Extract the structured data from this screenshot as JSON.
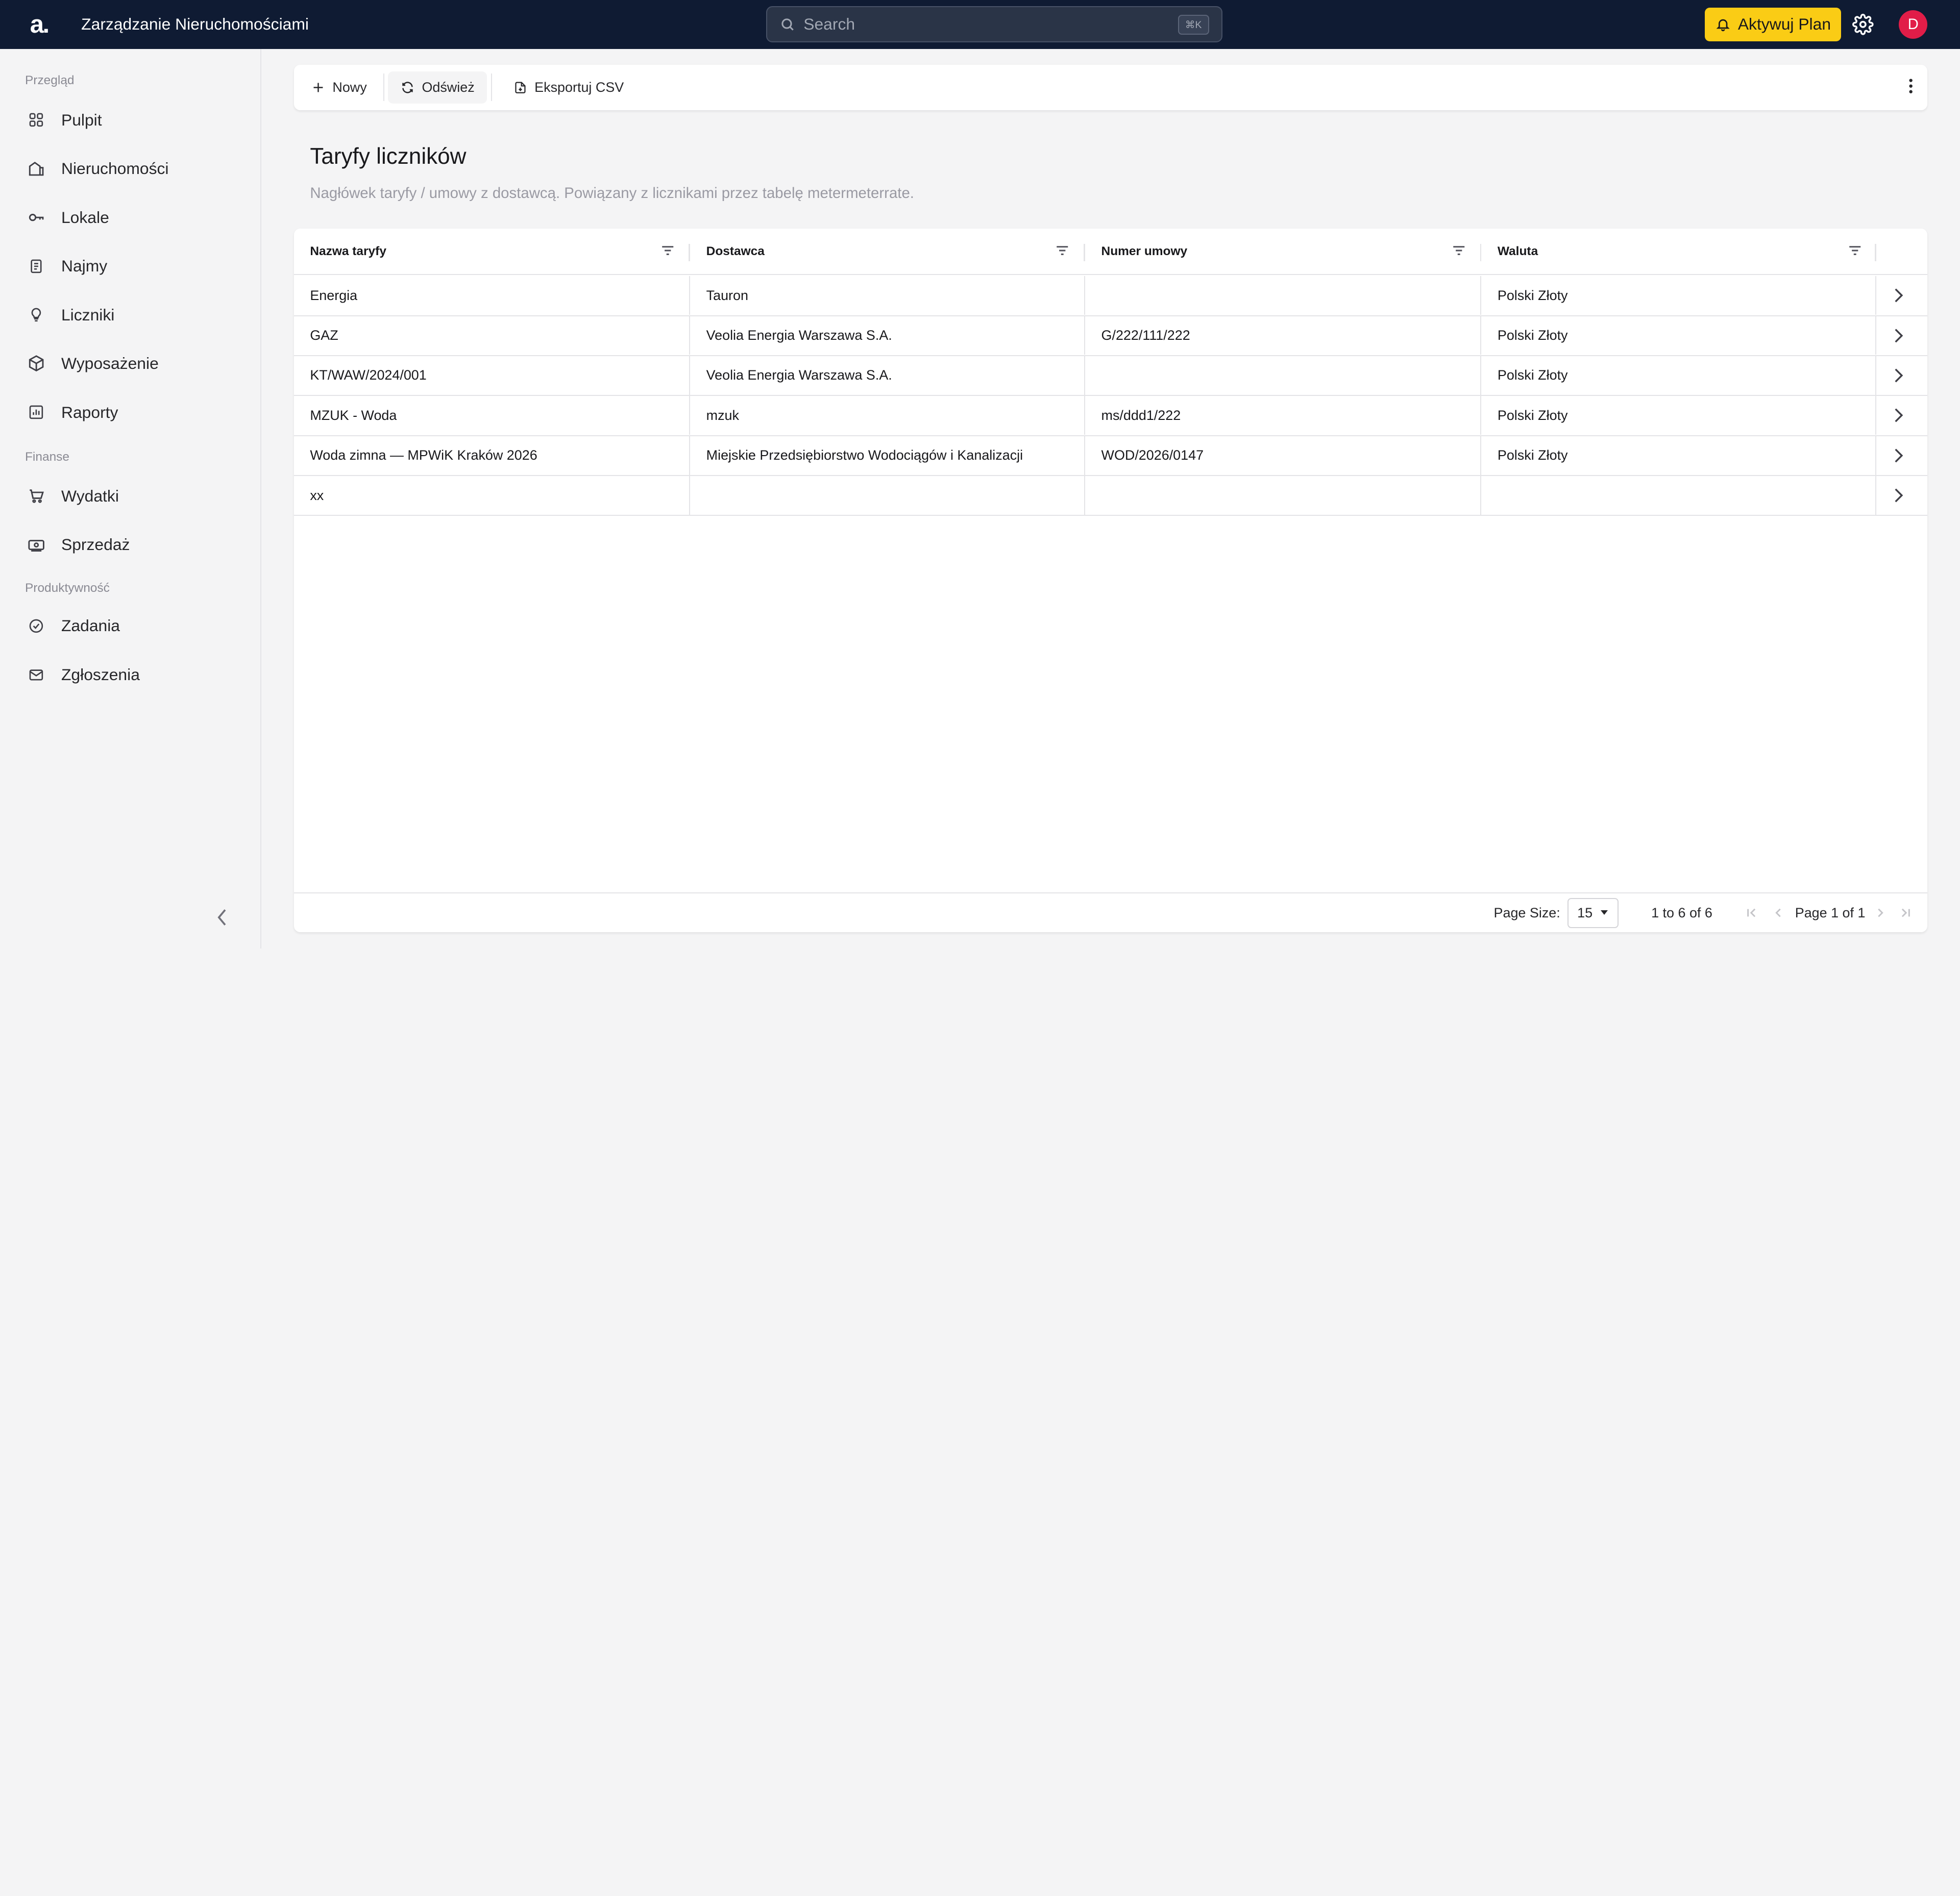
{
  "topbar": {
    "logo": "a.",
    "title": "Zarządzanie Nieruchomościami",
    "search_placeholder": "Search",
    "search_shortcut": "⌘K",
    "plan_button": "Aktywuj Plan",
    "avatar_initial": "D",
    "colors": {
      "background": "#0f1b33",
      "accent": "#facc15",
      "avatar": "#e11d48"
    }
  },
  "sidebar": {
    "sections": [
      {
        "label": "Przegląd",
        "items": [
          {
            "label": "Pulpit",
            "icon": "dashboard-icon"
          },
          {
            "label": "Nieruchomości",
            "icon": "building-icon"
          },
          {
            "label": "Lokale",
            "icon": "key-icon"
          },
          {
            "label": "Najmy",
            "icon": "document-icon"
          },
          {
            "label": "Liczniki",
            "icon": "bulb-icon"
          },
          {
            "label": "Wyposażenie",
            "icon": "box-icon"
          },
          {
            "label": "Raporty",
            "icon": "chart-icon"
          }
        ]
      },
      {
        "label": "Finanse",
        "items": [
          {
            "label": "Wydatki",
            "icon": "cart-icon"
          },
          {
            "label": "Sprzedaż",
            "icon": "cash-icon"
          }
        ]
      },
      {
        "label": "Produktywność",
        "items": [
          {
            "label": "Zadania",
            "icon": "check-circle-icon"
          },
          {
            "label": "Zgłoszenia",
            "icon": "mail-icon"
          }
        ]
      }
    ]
  },
  "toolbar": {
    "new_label": "Nowy",
    "refresh_label": "Odśwież",
    "export_label": "Eksportuj CSV"
  },
  "page": {
    "title": "Taryfy liczników",
    "description": "Nagłówek taryfy / umowy z dostawcą. Powiązany z licznikami przez tabelę metermeterrate."
  },
  "table": {
    "columns": [
      "Nazwa taryfy",
      "Dostawca",
      "Numer umowy",
      "Waluta"
    ],
    "rows": [
      [
        "Energia",
        "Tauron",
        "",
        "Polski Złoty"
      ],
      [
        "GAZ",
        "Veolia Energia Warszawa S.A.",
        "G/222/111/222",
        "Polski Złoty"
      ],
      [
        "KT/WAW/2024/001",
        "Veolia Energia Warszawa S.A.",
        "",
        "Polski Złoty"
      ],
      [
        "MZUK - Woda",
        "mzuk",
        "ms/ddd1/222",
        "Polski Złoty"
      ],
      [
        "Woda zimna — MPWiK Kraków 2026",
        "Miejskie Przedsiębiorstwo Wodociągów i Kanalizacji",
        "WOD/2026/0147",
        "Polski Złoty"
      ],
      [
        "xx",
        "",
        "",
        ""
      ]
    ]
  },
  "pagination": {
    "page_size_label": "Page Size:",
    "page_size": "15",
    "range": "1 to 6 of 6",
    "page_info": "Page 1 of 1"
  }
}
